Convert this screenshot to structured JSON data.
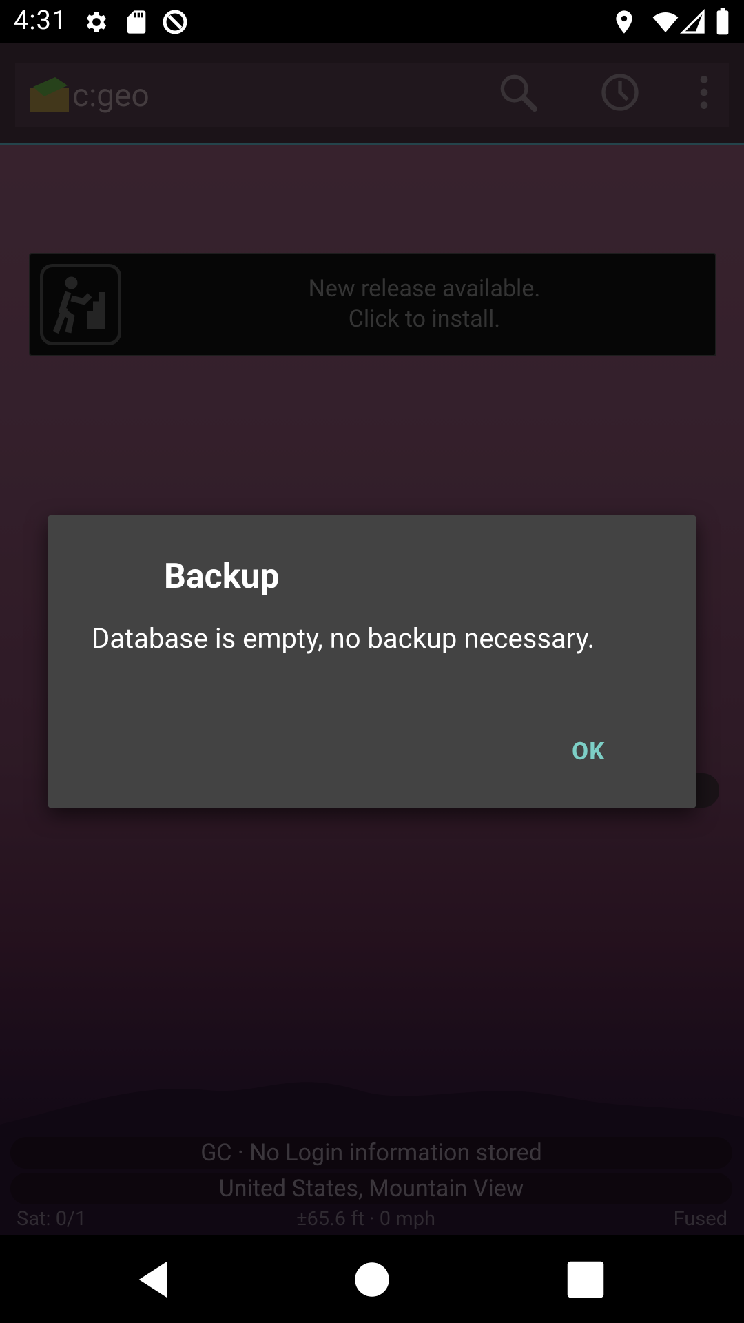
{
  "status_bar": {
    "time": "4:31",
    "left_icons": [
      "settings-icon",
      "sd-card-icon",
      "data-saver-icon"
    ],
    "right_icons": [
      "location-icon",
      "wifi-icon",
      "signal-icon",
      "battery-icon"
    ]
  },
  "toolbar": {
    "title": "c:geo",
    "actions": [
      "search-icon",
      "history-icon",
      "overflow-menu-icon"
    ]
  },
  "banner": {
    "line1": "New release available.",
    "line2": "Click to install."
  },
  "dialog": {
    "title": "Backup",
    "message": "Database is empty, no backup necessary.",
    "ok_label": "OK"
  },
  "footer": {
    "login_status": "GC · No Login information stored",
    "location": "United States, Mountain View",
    "satellites": "Sat: 0/1",
    "accuracy_speed": "±65.6 ft · 0 mph",
    "provider": "Fused"
  },
  "colors": {
    "accent": "#7dcfc6",
    "dialog_bg": "#434343"
  }
}
